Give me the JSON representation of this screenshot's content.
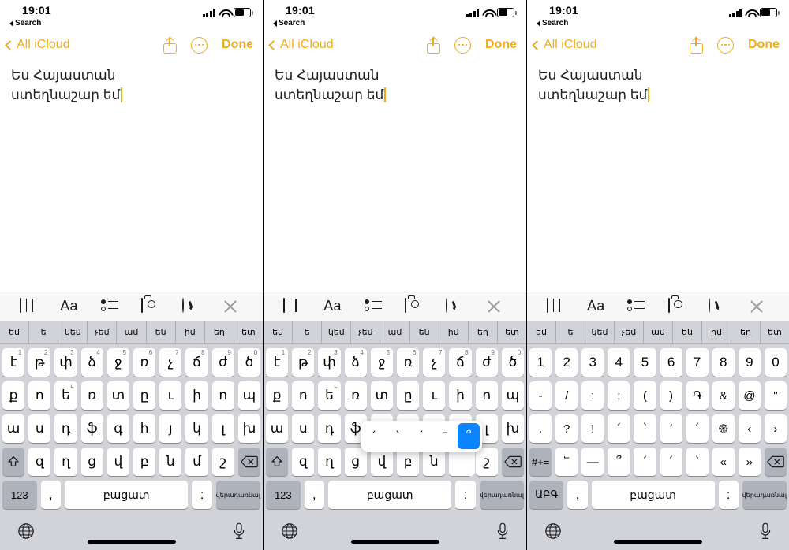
{
  "meta": {
    "app": "Notes",
    "platform": "iOS",
    "panels": 3
  },
  "status_bar": {
    "time": "19:01",
    "back_label": "Search",
    "icons": [
      "signal-bars-icon",
      "wifi-icon",
      "battery-icon"
    ]
  },
  "nav_bar": {
    "back_label": "All iCloud",
    "done_label": "Done",
    "share_icon": "share-icon",
    "more_icon": "more-ellipsis-icon",
    "accent_color": "#f0ae1b"
  },
  "note": {
    "line1": "Ես Հայաստան",
    "line2": "ստեղնաշար եմ",
    "has_caret": true
  },
  "note_toolbar": {
    "items": [
      {
        "name": "table-icon",
        "label": ""
      },
      {
        "name": "text-format-icon",
        "label": "Aa"
      },
      {
        "name": "checklist-icon",
        "label": ""
      },
      {
        "name": "camera-icon",
        "label": ""
      },
      {
        "name": "markup-pen-icon",
        "label": ""
      },
      {
        "name": "close-icon",
        "label": ""
      }
    ]
  },
  "keyboard": {
    "suggestions": [
      "եմ",
      "ե",
      "կեմ",
      "չեմ",
      "ամ",
      "են",
      "իմ",
      "եղ",
      "ետ"
    ],
    "armenian": {
      "row1": [
        {
          "k": "է",
          "sup": "1"
        },
        {
          "k": "թ",
          "sup": "2"
        },
        {
          "k": "փ",
          "sup": "3"
        },
        {
          "k": "ձ",
          "sup": "4"
        },
        {
          "k": "ջ",
          "sup": "5"
        },
        {
          "k": "ռ",
          "sup": "6"
        },
        {
          "k": "չ",
          "sup": "7"
        },
        {
          "k": "ճ",
          "sup": "8"
        },
        {
          "k": "ժ",
          "sup": "9"
        },
        {
          "k": "ծ",
          "sup": "0"
        }
      ],
      "row2": [
        {
          "k": "ք",
          "sup": ""
        },
        {
          "k": "ո",
          "sup": ""
        },
        {
          "k": "ե",
          "sup": "ւ"
        },
        {
          "k": "ռ",
          "sup": ""
        },
        {
          "k": "տ",
          "sup": ""
        },
        {
          "k": "ը",
          "sup": ""
        },
        {
          "k": "ւ",
          "sup": ""
        },
        {
          "k": "ի",
          "sup": ""
        },
        {
          "k": "ո",
          "sup": ""
        },
        {
          "k": "պ",
          "sup": ""
        }
      ],
      "row3": [
        {
          "k": "ա",
          "sup": ""
        },
        {
          "k": "ս",
          "sup": ""
        },
        {
          "k": "դ",
          "sup": ""
        },
        {
          "k": "ֆ",
          "sup": ""
        },
        {
          "k": "գ",
          "sup": ""
        },
        {
          "k": "հ",
          "sup": ""
        },
        {
          "k": "յ",
          "sup": ""
        },
        {
          "k": "կ",
          "sup": ""
        },
        {
          "k": "լ",
          "sup": ""
        },
        {
          "k": "խ",
          "sup": ""
        }
      ],
      "row4": [
        {
          "k": "զ",
          "sup": ""
        },
        {
          "k": "ղ",
          "sup": ""
        },
        {
          "k": "ց",
          "sup": ""
        },
        {
          "k": "վ",
          "sup": ""
        },
        {
          "k": "բ",
          "sup": ""
        },
        {
          "k": "ն",
          "sup": ""
        },
        {
          "k": "մ",
          "sup": ""
        },
        {
          "k": "շ",
          "sup": ""
        }
      ],
      "shift_icon": "shift-icon",
      "backspace_icon": "backspace-icon",
      "numbers_label": "123",
      "comma_label": ",",
      "space_label": "բացատ",
      "colon_label": ":",
      "return_label": "վերադառնալ"
    },
    "numeric": {
      "row1": [
        "1",
        "2",
        "3",
        "4",
        "5",
        "6",
        "7",
        "8",
        "9",
        "0"
      ],
      "row2": [
        "-",
        "/",
        ":",
        ";",
        "(",
        ")",
        "֏",
        "&",
        "@",
        "\""
      ],
      "row3": [
        ".",
        "?",
        "!",
        "՛",
        "՝",
        "՚",
        "՛",
        "֎",
        "‹",
        "›"
      ],
      "row4": [
        "՟",
        "—",
        "՞",
        "՛",
        "՛",
        "՝",
        "«",
        "»"
      ],
      "symbols_label": "#+=",
      "backspace_icon": "backspace-icon",
      "letters_label": "ԱԲԳ",
      "comma_label": ",",
      "space_label": "բացատ",
      "colon_label": ":",
      "return_label": "վերադառնալ"
    },
    "accent_popup": {
      "options": [
        "՛",
        "՝",
        "՛",
        "՟",
        "՞"
      ],
      "selected_index": 4,
      "selected_color": "#0a84ff"
    },
    "bottom": {
      "globe_icon": "globe-icon",
      "mic_icon": "microphone-icon"
    }
  }
}
